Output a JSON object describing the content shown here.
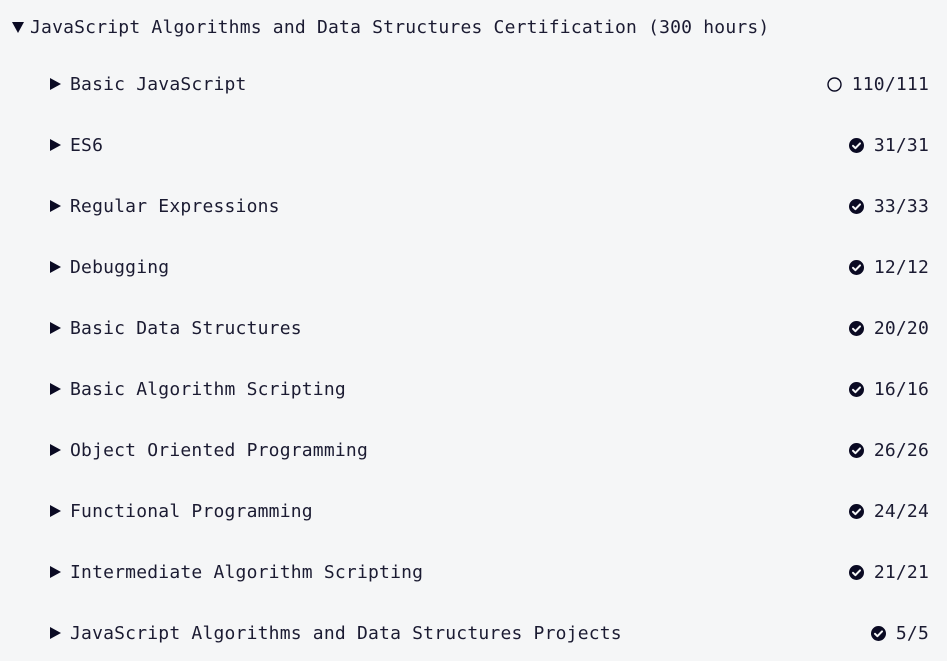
{
  "certification": {
    "title": "JavaScript Algorithms and Data Structures Certification (300 hours)",
    "expanded": true
  },
  "colors": {
    "text": "#1b1b32",
    "icon": "#0a0a23",
    "background": "#f5f6f7"
  },
  "blocks": [
    {
      "title": "Basic JavaScript",
      "progress": "110/111",
      "status": "incomplete",
      "icon": "circle-outline-icon"
    },
    {
      "title": "ES6",
      "progress": "31/31",
      "status": "complete",
      "icon": "check-circle-icon"
    },
    {
      "title": "Regular Expressions",
      "progress": "33/33",
      "status": "complete",
      "icon": "check-circle-icon"
    },
    {
      "title": "Debugging",
      "progress": "12/12",
      "status": "complete",
      "icon": "check-circle-icon"
    },
    {
      "title": "Basic Data Structures",
      "progress": "20/20",
      "status": "complete",
      "icon": "check-circle-icon"
    },
    {
      "title": "Basic Algorithm Scripting",
      "progress": "16/16",
      "status": "complete",
      "icon": "check-circle-icon"
    },
    {
      "title": "Object Oriented Programming",
      "progress": "26/26",
      "status": "complete",
      "icon": "check-circle-icon"
    },
    {
      "title": "Functional Programming",
      "progress": "24/24",
      "status": "complete",
      "icon": "check-circle-icon"
    },
    {
      "title": "Intermediate Algorithm Scripting",
      "progress": "21/21",
      "status": "complete",
      "icon": "check-circle-icon"
    },
    {
      "title": "JavaScript Algorithms and Data Structures Projects",
      "progress": "5/5",
      "status": "complete",
      "icon": "check-circle-icon"
    }
  ]
}
